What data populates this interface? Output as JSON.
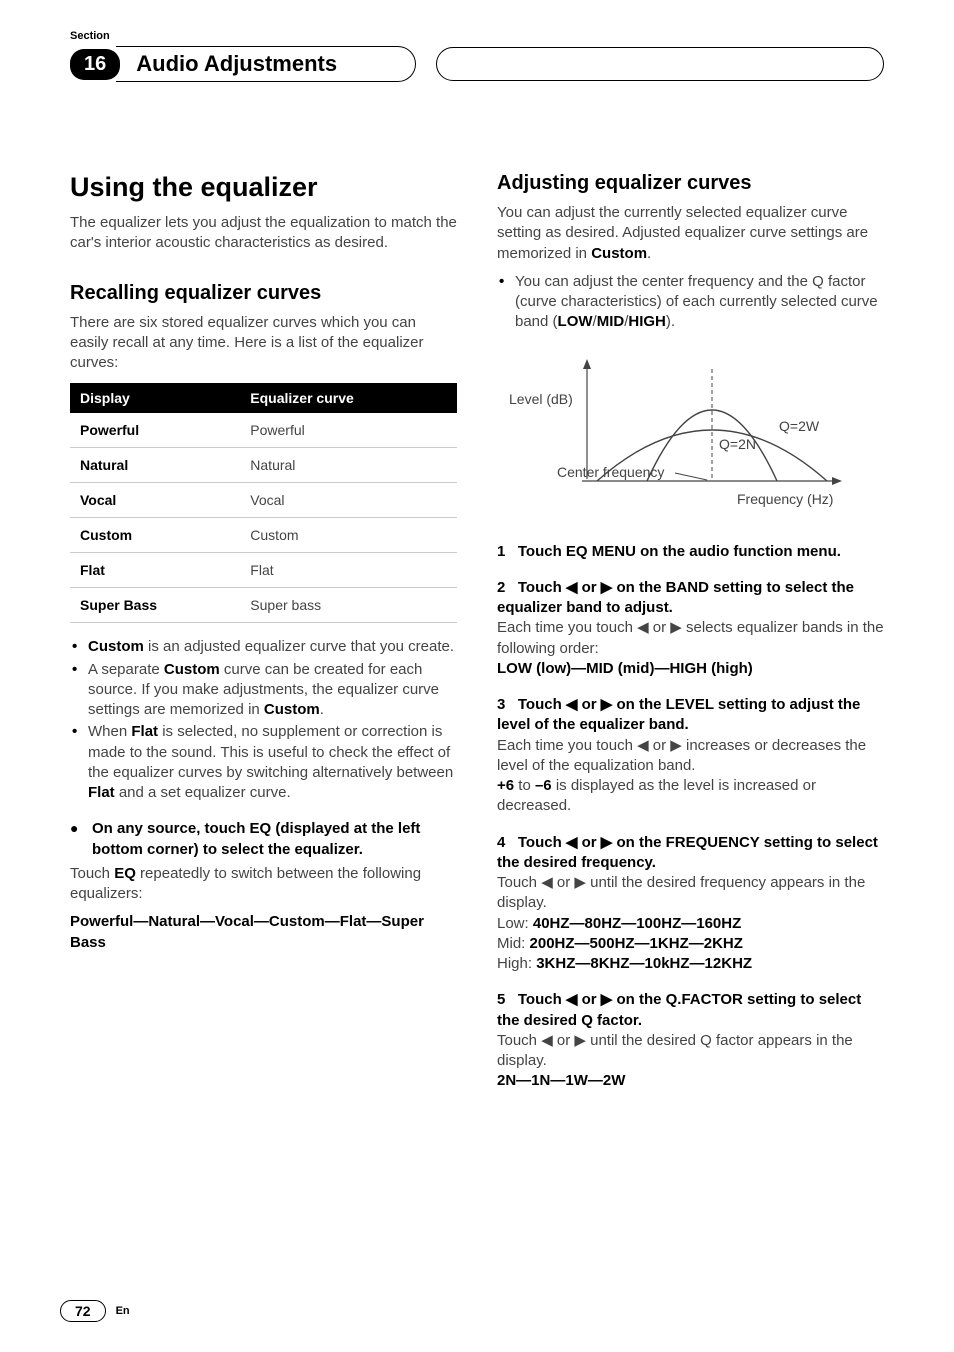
{
  "header": {
    "section_label": "Section",
    "section_number": "16",
    "title": "Audio Adjustments"
  },
  "left": {
    "h1": "Using the equalizer",
    "intro": "The equalizer lets you adjust the equalization to match the car's interior acoustic characteristics as desired.",
    "h2_recall": "Recalling equalizer curves",
    "recall_intro": "There are six stored equalizer curves which you can easily recall at any time. Here is a list of the equalizer curves:",
    "table": {
      "head_display": "Display",
      "head_curve": "Equalizer curve",
      "rows": [
        {
          "d": "Powerful",
          "c": "Powerful"
        },
        {
          "d": "Natural",
          "c": "Natural"
        },
        {
          "d": "Vocal",
          "c": "Vocal"
        },
        {
          "d": "Custom",
          "c": "Custom"
        },
        {
          "d": "Flat",
          "c": "Flat"
        },
        {
          "d": "Super Bass",
          "c": "Super bass"
        }
      ]
    },
    "bullets": {
      "b1_pre": "",
      "b1_bold": "Custom",
      "b1_post": " is an adjusted equalizer curve that you create.",
      "b2_pre": "A separate ",
      "b2_bold": "Custom",
      "b2_mid": " curve can be created for each source. If you make adjustments, the equalizer curve settings are memorized in ",
      "b2_bold2": "Custom",
      "b2_post": ".",
      "b3_pre": "When ",
      "b3_bold": "Flat",
      "b3_mid": " is selected, no supplement or correction is made to the sound. This is useful to check the effect of the equalizer curves by switching alternatively between ",
      "b3_bold2": "Flat",
      "b3_post": " and a set equalizer curve."
    },
    "big_bullet": "On any source, touch EQ (displayed at the left bottom corner) to select the equalizer.",
    "eq_repeat_pre": "Touch ",
    "eq_repeat_bold": "EQ",
    "eq_repeat_post": " repeatedly to switch between the following equalizers:",
    "eq_order": "Powerful—Natural—Vocal—Custom—Flat—Super Bass"
  },
  "right": {
    "h2_adjust": "Adjusting equalizer curves",
    "adjust_intro_pre": "You can adjust the currently selected equalizer curve setting as desired. Adjusted equalizer curve settings are memorized in ",
    "adjust_intro_bold": "Custom",
    "adjust_intro_post": ".",
    "bullet_pre": "You can adjust the center frequency and the Q factor (curve characteristics) of each currently selected curve band (",
    "bullet_bold1": "LOW",
    "bullet_slash1": "/",
    "bullet_bold2": "MID",
    "bullet_slash2": "/",
    "bullet_bold3": "HIGH",
    "bullet_post": ").",
    "diagram": {
      "level": "Level (dB)",
      "q2n": "Q=2N",
      "q2w": "Q=2W",
      "center": "Center frequency",
      "freq": "Frequency (Hz)"
    },
    "steps": {
      "s1_num": "1",
      "s1_head": "Touch EQ MENU on the audio function menu.",
      "s2_num": "2",
      "s2_head": "Touch ◀ or ▶ on the BAND setting to select the equalizer band to adjust.",
      "s2_body_pre": "Each time you touch ◀ or ▶ selects equalizer bands in the following order:",
      "s2_order": "LOW (low)—MID (mid)—HIGH (high)",
      "s3_num": "3",
      "s3_head": "Touch ◀ or ▶ on the LEVEL setting to adjust the level of the equalizer band.",
      "s3_body_pre": "Each time you touch ◀ or ▶ increases or decreases the level of the equalization band.",
      "s3_body2_bold1": "+6",
      "s3_body2_mid": " to ",
      "s3_body2_bold2": "–6",
      "s3_body2_post": " is displayed as the level is increased or decreased.",
      "s4_num": "4",
      "s4_head": "Touch ◀ or ▶ on the FREQUENCY setting to select the desired frequency.",
      "s4_body": "Touch ◀ or ▶ until the desired frequency appears in the display.",
      "s4_low_label": "Low: ",
      "s4_low": "40HZ—80HZ—100HZ—160HZ",
      "s4_mid_label": "Mid: ",
      "s4_mid": "200HZ—500HZ—1KHZ—2KHZ",
      "s4_high_label": "High: ",
      "s4_high": "3KHZ—8KHZ—10kHZ—12KHZ",
      "s5_num": "5",
      "s5_head": "Touch ◀ or ▶ on the Q.FACTOR setting to select the desired Q factor.",
      "s5_body": "Touch ◀ or ▶ until the desired Q factor appears in the display.",
      "s5_order": "2N—1N—1W—2W"
    }
  },
  "footer": {
    "page": "72",
    "lang": "En"
  }
}
